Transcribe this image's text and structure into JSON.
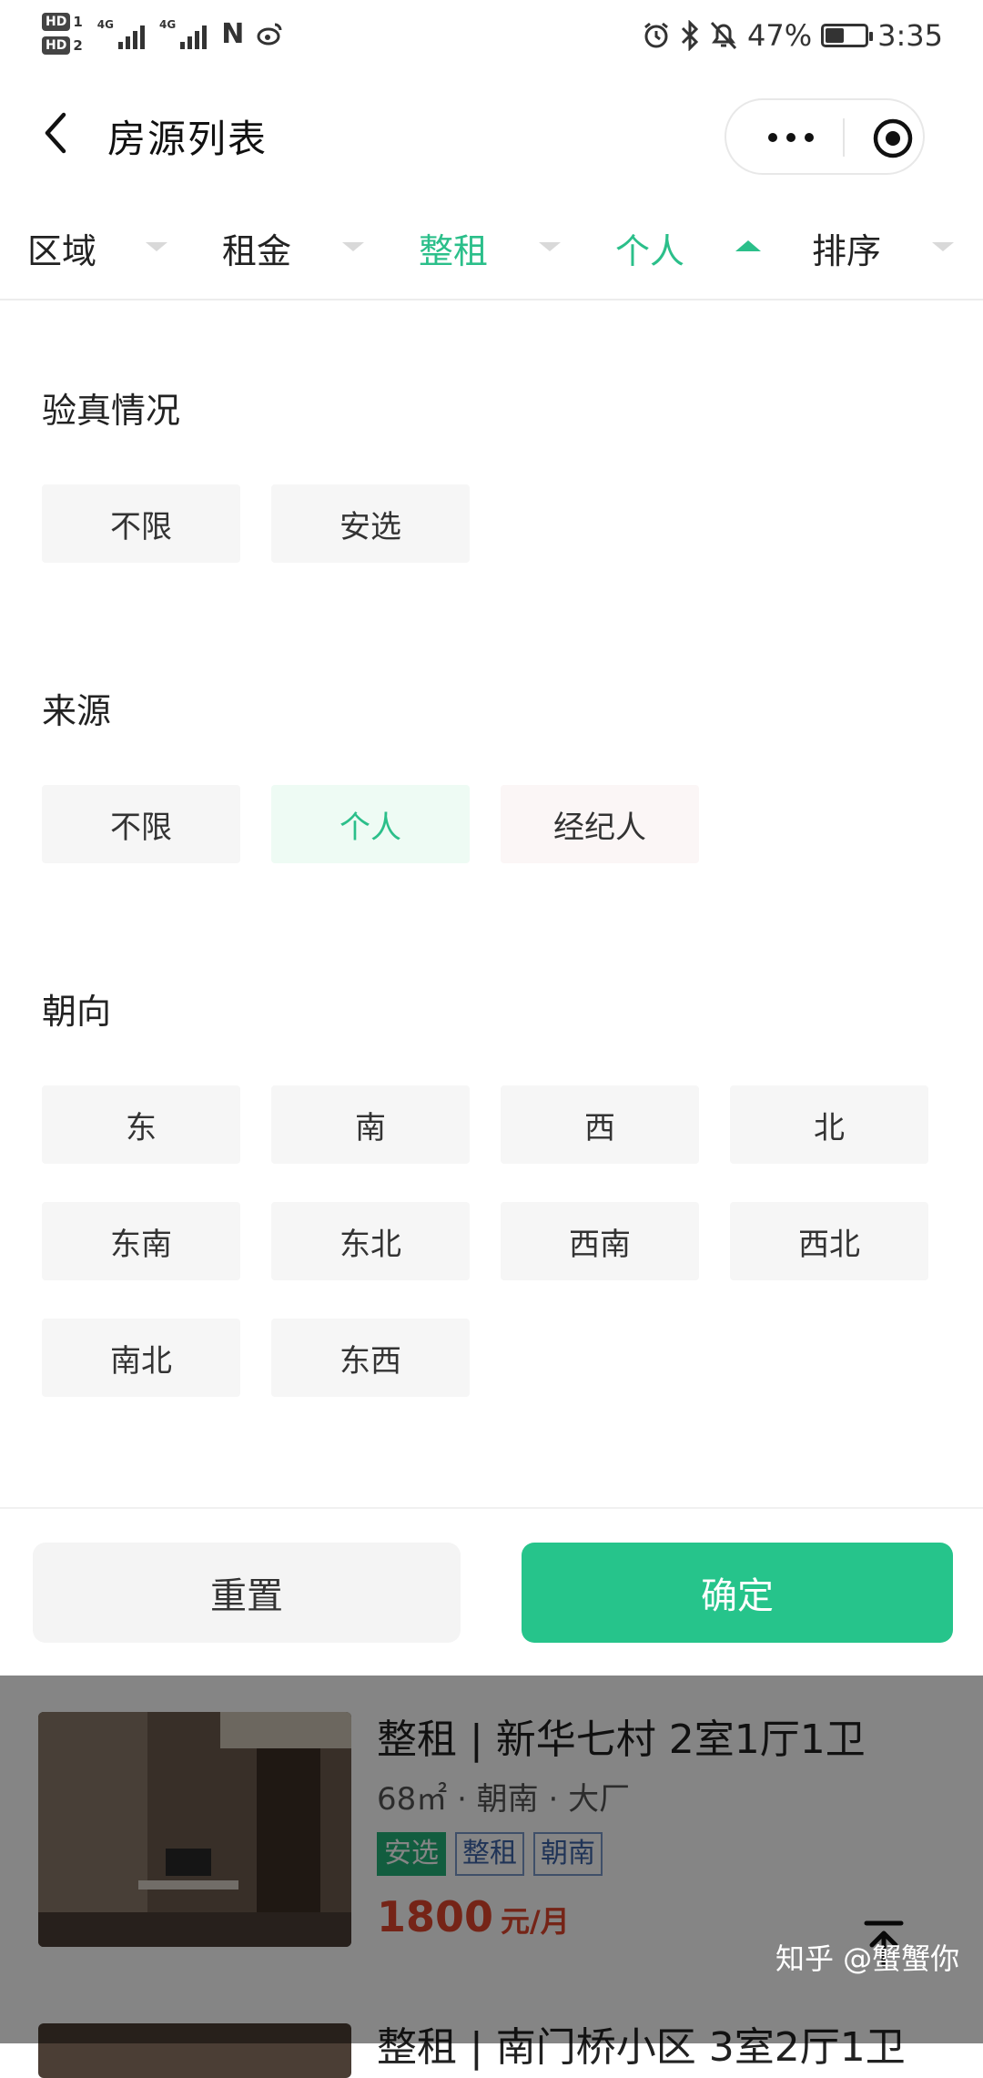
{
  "status_bar": {
    "hd1": "HD",
    "hd1_sub": "1",
    "hd2": "HD",
    "hd2_sub": "2",
    "network1": "4G",
    "network2": "4G",
    "battery_percent": "47%",
    "battery_level": 0.47,
    "time": "3:35",
    "icons": [
      "signal-icon",
      "nfc-icon",
      "weibo-icon",
      "alarm-icon",
      "bluetooth-icon",
      "mute-icon",
      "battery-icon"
    ]
  },
  "nav": {
    "title": "房源列表",
    "icons": [
      "back-icon",
      "more-icon",
      "close-icon"
    ]
  },
  "filter_tabs": [
    {
      "label": "区域",
      "active": false
    },
    {
      "label": "租金",
      "active": false
    },
    {
      "label": "整租",
      "active": true
    },
    {
      "label": "个人",
      "active": true,
      "expanded": true
    },
    {
      "label": "排序",
      "active": false
    }
  ],
  "sections": {
    "verify": {
      "title": "验真情况",
      "options": [
        "不限",
        "安选"
      ]
    },
    "source": {
      "title": "来源",
      "options": [
        "不限",
        "个人",
        "经纪人"
      ],
      "selected": "个人"
    },
    "orientation": {
      "title": "朝向",
      "options": [
        "东",
        "南",
        "西",
        "北",
        "东南",
        "东北",
        "西南",
        "西北",
        "南北",
        "东西"
      ]
    }
  },
  "footer": {
    "reset_label": "重置",
    "confirm_label": "确定"
  },
  "listings": [
    {
      "title": "整租 | 新华七村 2室1厅1卫",
      "meta": "68㎡ · 朝南 · 大厂",
      "tags": [
        "安选",
        "整租",
        "朝南"
      ],
      "price": "1800",
      "price_unit": "元/月"
    },
    {
      "title": "整租 | 南门桥小区 3室2厅1卫"
    }
  ],
  "watermark": "知乎 @蟹蟹你",
  "colors": {
    "accent": "#2bbf8a",
    "confirm_button": "#26c48b",
    "price": "#e0452c"
  }
}
